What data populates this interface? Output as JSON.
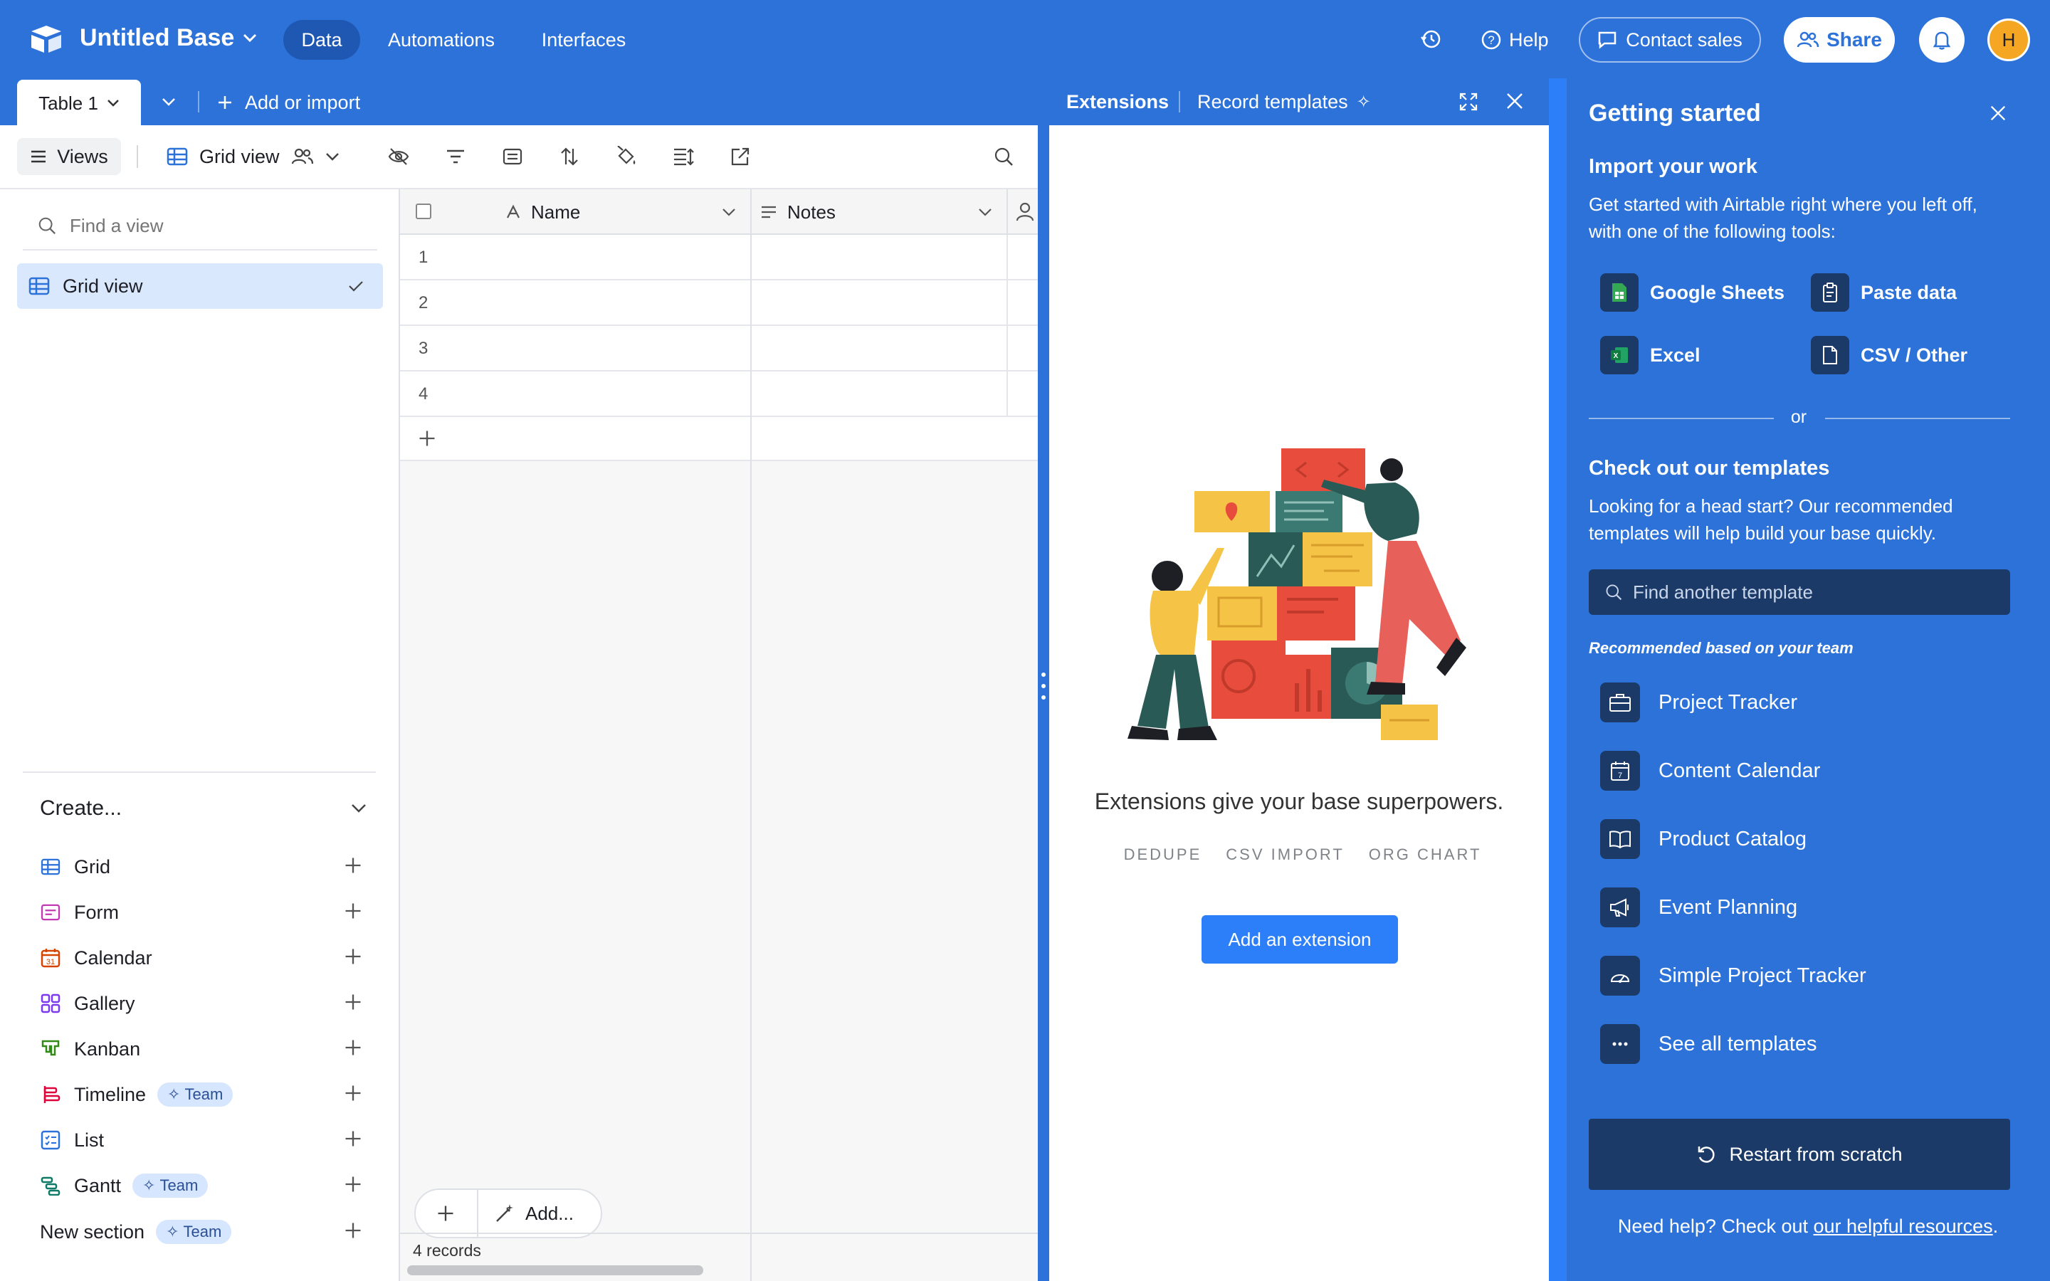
{
  "header": {
    "base_name": "Untitled Base",
    "nav": [
      "Data",
      "Automations",
      "Interfaces"
    ],
    "help": "Help",
    "contact_sales": "Contact sales",
    "share": "Share",
    "avatar_initial": "H"
  },
  "tabs": {
    "table_name": "Table 1",
    "add_or_import": "Add or import"
  },
  "toolbar": {
    "views": "Views",
    "view_name": "Grid view"
  },
  "sidebar": {
    "find_placeholder": "Find a view",
    "views": [
      {
        "label": "Grid view"
      }
    ],
    "create_label": "Create...",
    "create_items": [
      {
        "label": "Grid",
        "team": ""
      },
      {
        "label": "Form",
        "team": ""
      },
      {
        "label": "Calendar",
        "team": ""
      },
      {
        "label": "Gallery",
        "team": ""
      },
      {
        "label": "Kanban",
        "team": ""
      },
      {
        "label": "Timeline",
        "team": "Team"
      },
      {
        "label": "List",
        "team": ""
      },
      {
        "label": "Gantt",
        "team": "Team"
      },
      {
        "label": "New section",
        "team": "Team"
      }
    ]
  },
  "grid": {
    "columns": [
      "Name",
      "Notes"
    ],
    "rows": [
      "1",
      "2",
      "3",
      "4"
    ],
    "add_label": "Add...",
    "record_count": "4 records"
  },
  "extensions": {
    "tab_extensions": "Extensions",
    "tab_record_templates": "Record templates",
    "headline": "Extensions give your base superpowers.",
    "tags": [
      "DEDUPE",
      "CSV IMPORT",
      "ORG CHART"
    ],
    "add_button": "Add an extension"
  },
  "getting_started": {
    "title": "Getting started",
    "import_title": "Import your work",
    "import_desc_1": "Get started with Airtable right where you left off,",
    "import_desc_2": "with one of the following tools:",
    "import_tools": [
      "Google Sheets",
      "Paste data",
      "Excel",
      "CSV / Other"
    ],
    "or": "or",
    "templates_title": "Check out our templates",
    "templates_desc_1": "Looking for a head start? Our recommended",
    "templates_desc_2": "templates will help build your base quickly.",
    "search_placeholder": "Find another template",
    "recommended_label": "Recommended based on your team",
    "templates": [
      "Project Tracker",
      "Content Calendar",
      "Product Catalog",
      "Event Planning",
      "Simple Project Tracker",
      "See all templates"
    ],
    "restart": "Restart from scratch",
    "help_prefix": "Need help? Check out ",
    "help_link": "our helpful resources",
    "help_suffix": "."
  },
  "colors": {
    "brand_blue": "#2d72d9",
    "panel_dark": "#1c3a68",
    "button_blue": "#2d7ff9"
  }
}
